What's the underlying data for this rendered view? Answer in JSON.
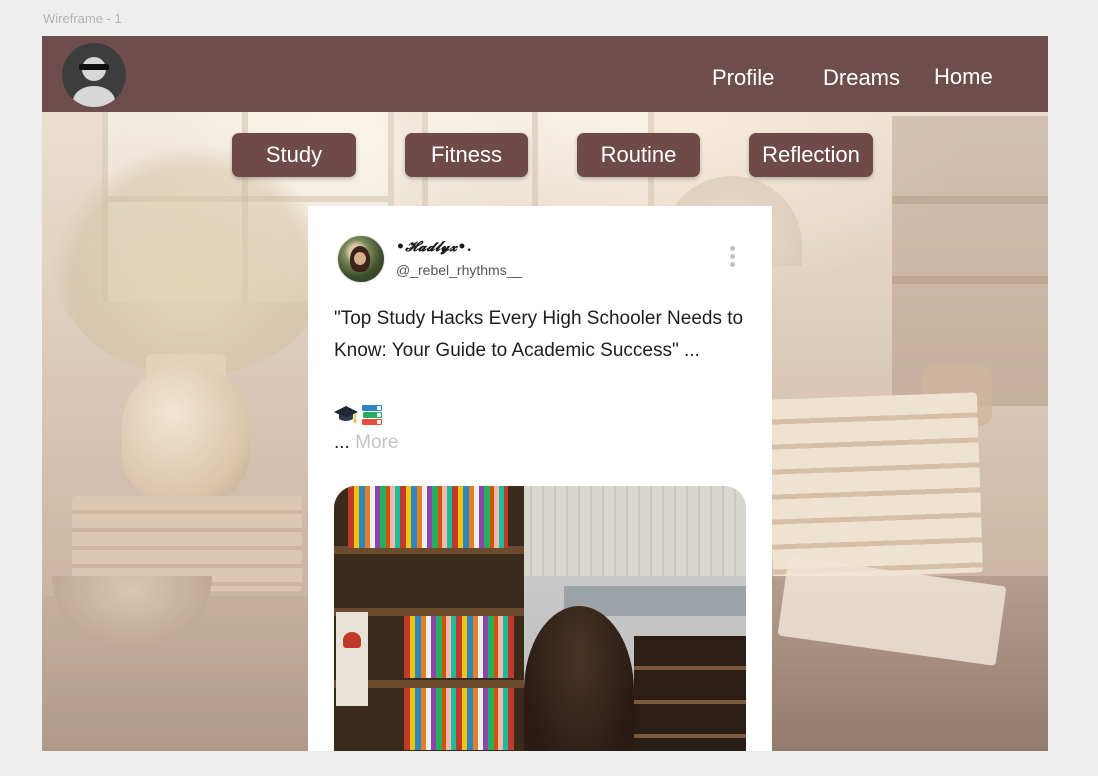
{
  "canvas_label": "Wireframe - 1",
  "nav": {
    "links": [
      "Profile",
      "Dreams",
      "Home"
    ]
  },
  "categories": [
    "Study",
    "Fitness",
    "Routine",
    "Reflection"
  ],
  "post": {
    "display_name": "•𝓗𝓪𝓭𝓵𝔂𝔁•.",
    "handle": "@_rebel_rhythms__",
    "text": "\"Top Study Hacks Every High Schooler Needs to Know: Your Guide to Academic Success\" ...",
    "emojis": [
      "graduation-cap-icon",
      "books-icon"
    ],
    "more_prefix": "...",
    "more_label": "More"
  },
  "colors": {
    "topbar": "#6e4e4d",
    "chip": "#6e4a48",
    "card": "#ffffff",
    "muted_text": "#c4c4c4"
  }
}
